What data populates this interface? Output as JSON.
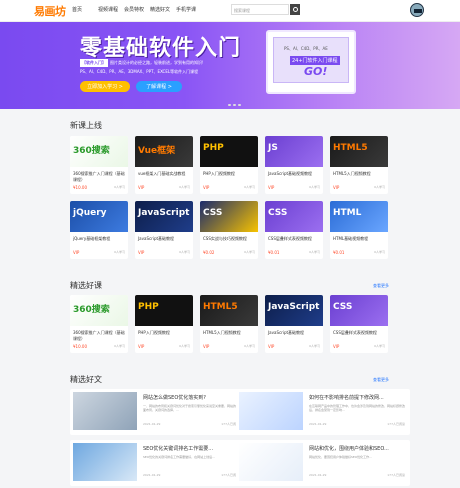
{
  "header": {
    "logo": "易画坊",
    "nav": [
      "首页",
      "视频课程",
      "会员特权",
      "精选好文",
      "手机学课"
    ],
    "search_placeholder": "搜索课程"
  },
  "banner": {
    "title": "零基础软件入门",
    "tag": "【软件入门】",
    "line1": "图片类设计的必经之路，轻装前进，学到有用的知识!",
    "line2": "PS、AI、C4D、PR、AE、3DMAX、PPT、EXCEL等软件入门课程",
    "btn_primary": "立即加入学习 >",
    "btn_secondary": "了解课程 >",
    "screen_text1": "PS、AI、C4D、PR、AE",
    "screen_text2": "24+门软件入门课程",
    "screen_go": "GO!"
  },
  "new_courses": {
    "title": "新课上线",
    "items": [
      {
        "title": "360搜索推广入门课程（基础课程）",
        "thumb": "360搜索",
        "price": "¥10.00",
        "sales": "0人学习",
        "variant": "green"
      },
      {
        "title": "vue框架入门基础实战教程",
        "thumb": "Vue框架",
        "price": "VIP",
        "sales": "0人学习",
        "variant": "dark"
      },
      {
        "title": "PHP入门视频教程",
        "thumb": "PHP",
        "price": "VIP",
        "sales": "0人学习",
        "variant": "black"
      },
      {
        "title": "JavaScript基础视频教程",
        "thumb": "JS",
        "price": "VIP",
        "sales": "0人学习",
        "variant": "purple"
      },
      {
        "title": "HTML5入门视频教程",
        "thumb": "HTML5",
        "price": "VIP",
        "sales": "0人学习",
        "variant": "dark"
      },
      {
        "title": "jQuery基础框架教程",
        "thumb": "jQuery",
        "price": "VIP",
        "sales": "0人学习",
        "variant": "blue"
      },
      {
        "title": "JavaScript基础教程",
        "thumb": "JavaScript",
        "price": "VIP",
        "sales": "0人学习",
        "variant": "darkblue"
      },
      {
        "title": "CSS实战与技巧视频教程",
        "thumb": "CSS",
        "price": "¥0.02",
        "sales": "0人学习",
        "variant": "yellow"
      },
      {
        "title": "CSS层叠样式表视频教程",
        "thumb": "CSS",
        "price": "¥0.01",
        "sales": "0人学习",
        "variant": "purple"
      },
      {
        "title": "HTML基础视频教程",
        "thumb": "HTML",
        "price": "¥0.01",
        "sales": "0人学习",
        "variant": "lightblue"
      }
    ]
  },
  "good_courses": {
    "title": "精选好课",
    "more": "查看更多",
    "items": [
      {
        "title": "360搜索推广入门课程（基础课程）",
        "thumb": "360搜索",
        "price": "¥10.00",
        "sales": "0人学习",
        "variant": "green"
      },
      {
        "title": "PHP入门视频教程",
        "thumb": "PHP",
        "price": "VIP",
        "sales": "0人学习",
        "variant": "black"
      },
      {
        "title": "HTML5入门视频教程",
        "thumb": "HTML5",
        "price": "VIP",
        "sales": "0人学习",
        "variant": "dark"
      },
      {
        "title": "JavaScript基础教程",
        "thumb": "JavaScript",
        "price": "VIP",
        "sales": "0人学习",
        "variant": "darkblue"
      },
      {
        "title": "CSS层叠样式表视频教程",
        "thumb": "CSS",
        "price": "VIP",
        "sales": "0人学习",
        "variant": "purple"
      }
    ]
  },
  "articles": {
    "title": "精选好文",
    "more": "查看更多",
    "items": [
      {
        "title": "网站怎么做SEO优化落实到?",
        "desc": "一、网站的布局和关键词优化对于搜索引擎优化来说至关重要，网站的页面布局，关键词的选择，...",
        "date": "2021-01-29",
        "views": "177人已阅读"
      },
      {
        "title": "如何在不影响排名前提下修改网...",
        "desc": "在互联网产品中的管理工作中，也许会涉及到网站的修改，网站标题修改后，排名会受到一定影响...",
        "date": "2021-01-29",
        "views": "177人已阅读"
      },
      {
        "title": "SEO优化关键词排名工作需要...",
        "desc": "SEO优化的关键词排名工作需要做好，在网站上线后...",
        "date": "2021-01-29",
        "views": "177人已阅读"
      },
      {
        "title": "网站和优化，围绕用户体验和SEO...",
        "desc": "网站优化，要围绕用户体验做好SEO优化工作...",
        "date": "2021-01-29",
        "views": "177人已阅读"
      }
    ]
  },
  "colors": {
    "accent": "#7a4af0",
    "brand": "#ff7a00",
    "price": "#ff4a2a",
    "link": "#2a7aff"
  }
}
